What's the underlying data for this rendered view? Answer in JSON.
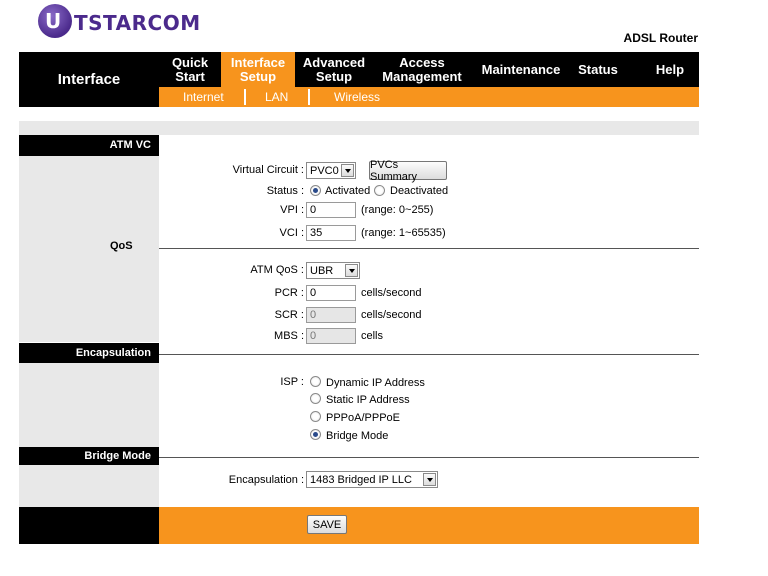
{
  "brand": {
    "logo_letter": "U",
    "logo_name": "TSTARCOM",
    "product": "ADSL Router"
  },
  "section_title": "Interface",
  "nav": [
    {
      "line1": "Quick",
      "line2": "Start",
      "active": false
    },
    {
      "line1": "Interface",
      "line2": "Setup",
      "active": true
    },
    {
      "line1": "Advanced",
      "line2": "Setup",
      "active": false
    },
    {
      "line1": "Access",
      "line2": "Management",
      "active": false
    },
    {
      "line1": "Maintenance",
      "line2": "",
      "active": false
    },
    {
      "line1": "Status",
      "line2": "",
      "active": false
    },
    {
      "line1": "Help",
      "line2": "",
      "active": false
    }
  ],
  "subnav": [
    "Internet",
    "LAN",
    "Wireless"
  ],
  "sections": {
    "atm_vc": "ATM VC",
    "qos": "QoS",
    "encapsulation": "Encapsulation",
    "bridge_mode": "Bridge Mode"
  },
  "atm": {
    "vc_label": "Virtual Circuit :",
    "vc_value": "PVC0",
    "summary_button": "PVCs Summary",
    "status_label": "Status :",
    "status_options": [
      "Activated",
      "Deactivated"
    ],
    "status_selected": "Activated",
    "vpi_label": "VPI :",
    "vpi_value": "0",
    "vpi_range": "(range: 0~255)",
    "vci_label": "VCI :",
    "vci_value": "35",
    "vci_range": "(range: 1~65535)"
  },
  "qos": {
    "atm_qos_label": "ATM QoS :",
    "atm_qos_value": "UBR",
    "pcr_label": "PCR :",
    "pcr_value": "0",
    "pcr_unit": "cells/second",
    "scr_label": "SCR :",
    "scr_value": "0",
    "scr_unit": "cells/second",
    "mbs_label": "MBS :",
    "mbs_value": "0",
    "mbs_unit": "cells"
  },
  "encap": {
    "isp_label": "ISP :",
    "options": [
      "Dynamic IP Address",
      "Static IP Address",
      "PPPoA/PPPoE",
      "Bridge Mode"
    ],
    "selected": "Bridge Mode"
  },
  "bridge": {
    "encap_label": "Encapsulation :",
    "encap_value": "1483 Bridged IP LLC"
  },
  "save_label": "SAVE",
  "colors": {
    "accent": "#f7941d",
    "bar": "#000000",
    "panel": "#e8e8e8",
    "brand": "#4b2a8c"
  }
}
